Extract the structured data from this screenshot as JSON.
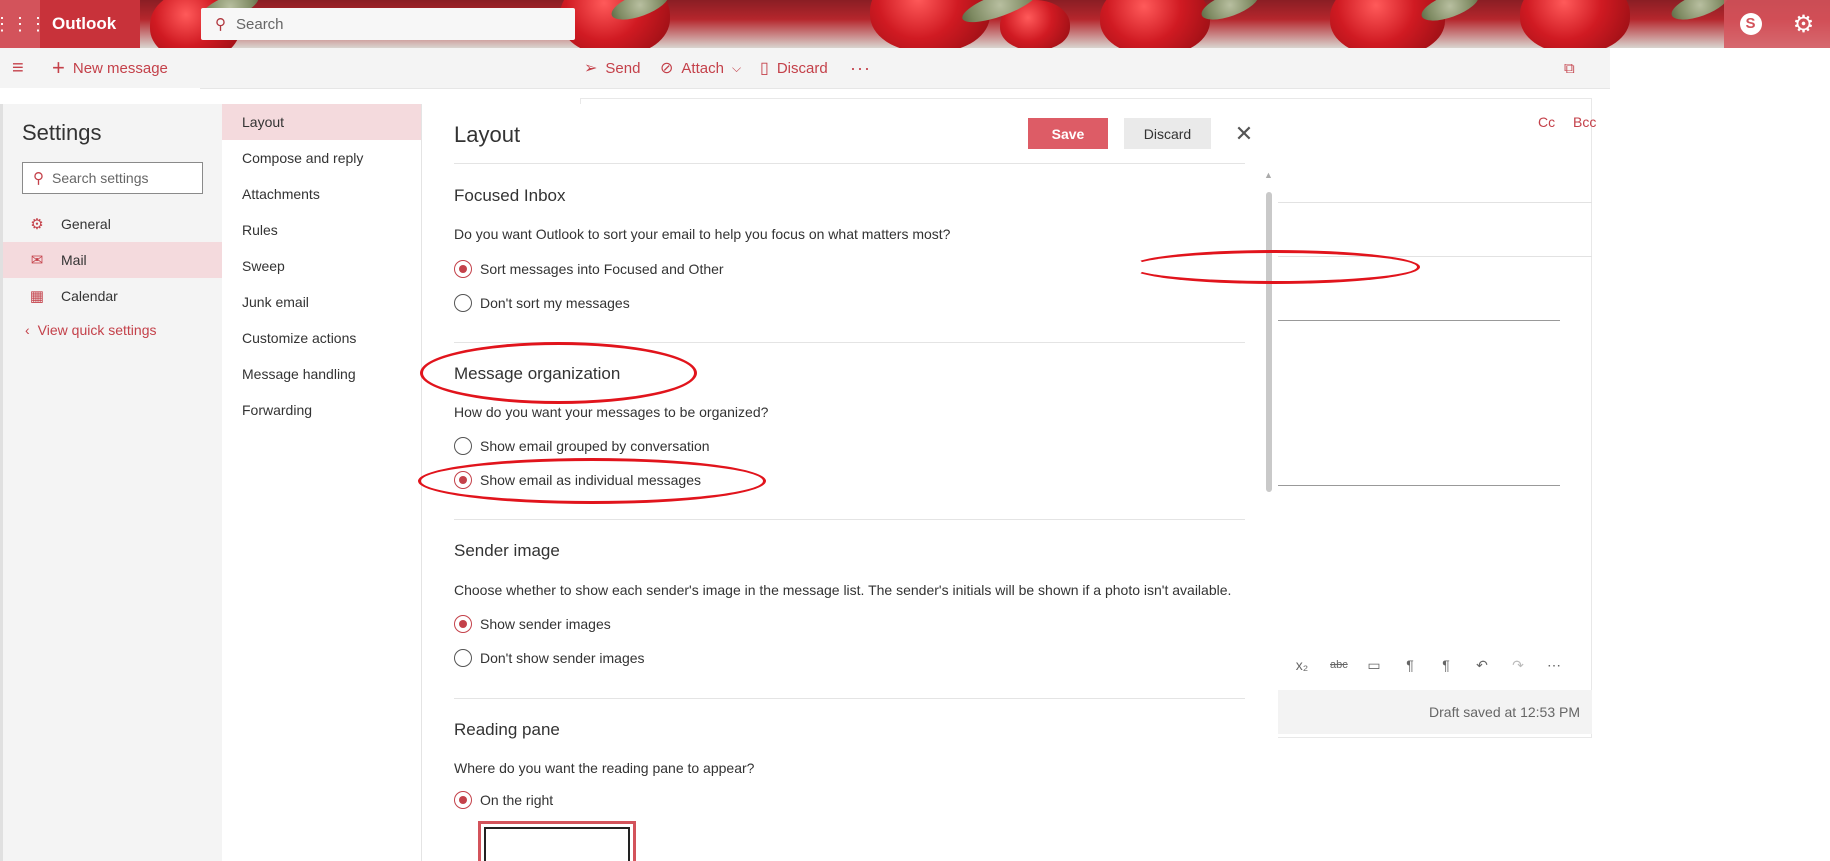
{
  "header": {
    "app_name": "Outlook",
    "search_placeholder": "Search",
    "waffle_icon": "app-launcher-icon",
    "skype_icon": "skype-icon",
    "settings_icon": "gear-icon"
  },
  "commandbar": {
    "new_message_label": "New message",
    "send_label": "Send",
    "attach_label": "Attach",
    "discard_label": "Discard",
    "more_label": "···"
  },
  "compose": {
    "cc_label": "Cc",
    "bcc_label": "Bcc",
    "draft_status": "Draft saved at 12:53 PM"
  },
  "settings": {
    "title": "Settings",
    "search_placeholder": "Search settings",
    "categories": [
      {
        "label": "General",
        "icon": "gear-icon"
      },
      {
        "label": "Mail",
        "icon": "mail-icon"
      },
      {
        "label": "Calendar",
        "icon": "calendar-icon"
      }
    ],
    "view_quick_settings": "View quick settings",
    "subnav": [
      "Layout",
      "Compose and reply",
      "Attachments",
      "Rules",
      "Sweep",
      "Junk email",
      "Customize actions",
      "Message handling",
      "Forwarding"
    ]
  },
  "panel": {
    "title": "Layout",
    "save_label": "Save",
    "discard_label": "Discard",
    "sections": {
      "focused": {
        "title": "Focused Inbox",
        "desc": "Do you want Outlook to sort your email to help you focus on what matters most?",
        "opt1": "Sort messages into Focused and Other",
        "opt2": "Don't sort my messages"
      },
      "organization": {
        "title": "Message organization",
        "desc": "How do you want your messages to be organized?",
        "opt1": "Show email grouped by conversation",
        "opt2": "Show email as individual messages"
      },
      "sender": {
        "title": "Sender image",
        "desc": "Choose whether to show each sender's image in the message list. The sender's initials will be shown if a photo isn't available.",
        "opt1": "Show sender images",
        "opt2": "Don't show sender images"
      },
      "reading": {
        "title": "Reading pane",
        "desc": "Where do you want the reading pane to appear?",
        "opt1": "On the right"
      }
    }
  },
  "colors": {
    "accent": "#c4414a",
    "save_button": "#dd5c66",
    "selected_bg": "#f4dadd",
    "annotation": "#e1141c"
  }
}
